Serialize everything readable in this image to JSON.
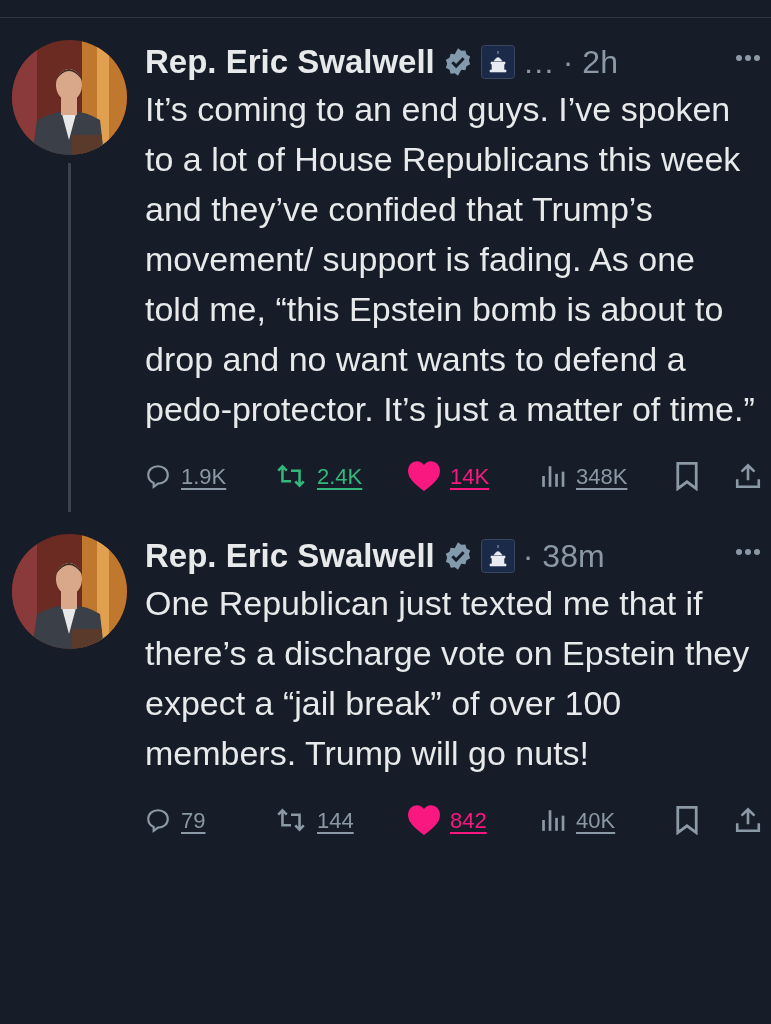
{
  "tweets": [
    {
      "name": "Rep. Eric Swalwell",
      "verified": true,
      "ellipsis": "…",
      "time": "· 2h",
      "thread_line": true,
      "text": "It’s coming to an end guys. I’ve spoken to a lot of House Republicans this week and they’ve confided that Trump’s movement/ support is fading. As one told me, “this Epstein bomb is about to drop and no want wants to defend a pedo-protector. It’s just a matter of time.”",
      "replies": "1.9K",
      "reposts": "2.4K",
      "reposted": true,
      "likes": "14K",
      "liked": true,
      "views": "348K"
    },
    {
      "name": "Rep. Eric Swalwell",
      "verified": true,
      "time": "· 38m",
      "thread_line": false,
      "text": "One Republican just texted me that if there’s a discharge vote on Epstein they expect a “jail break” of over 100 members.  Trump will go nuts!",
      "replies": "79",
      "reposts": "144",
      "reposted": false,
      "likes": "842",
      "liked": true,
      "views": "40K"
    }
  ]
}
